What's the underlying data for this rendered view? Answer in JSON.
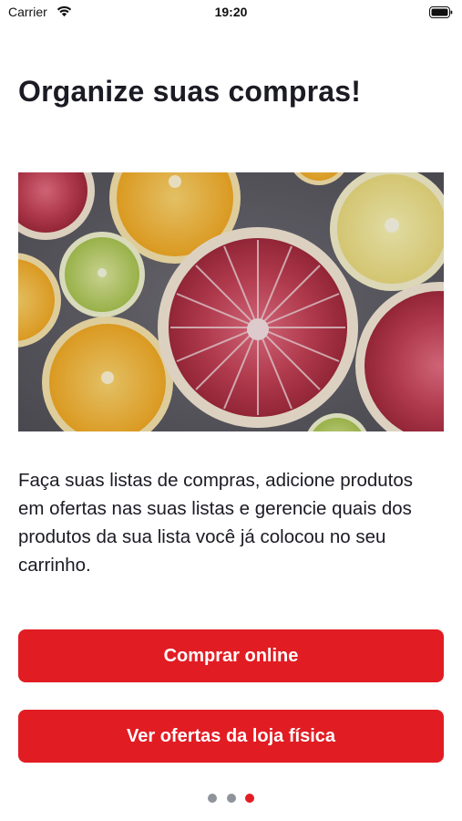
{
  "status_bar": {
    "carrier": "Carrier",
    "time": "19:20"
  },
  "onboarding": {
    "title": "Organize suas compras!",
    "description": "Faça suas listas de compras, adicione produtos em ofertas nas suas listas e gerencie quais dos produtos da sua lista você já colocou no seu carrinho.",
    "primary_button": "Comprar online",
    "secondary_button": "Ver ofertas da loja física",
    "page_indicator": {
      "total": 3,
      "current": 3
    }
  },
  "colors": {
    "accent": "#e21c23",
    "text": "#1b1b24",
    "dot_inactive": "#8f949b"
  },
  "icons": {
    "wifi": "wifi-icon",
    "battery": "battery-icon"
  }
}
